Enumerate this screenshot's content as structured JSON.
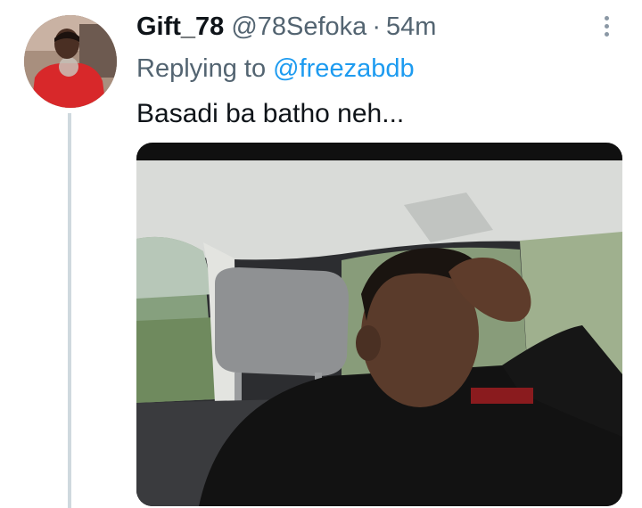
{
  "tweet": {
    "display_name": "Gift_78",
    "handle": "@78Sefoka",
    "separator": "·",
    "timestamp": "54m",
    "reply_prefix": "Replying to",
    "reply_to": "@freezabdb",
    "text": "Basadi ba batho neh...",
    "more_icon": "more-vertical-icon"
  },
  "colors": {
    "primary_text": "#0f1419",
    "secondary_text": "#536471",
    "link": "#1d9bf0",
    "thread_line": "#cfd9de"
  }
}
